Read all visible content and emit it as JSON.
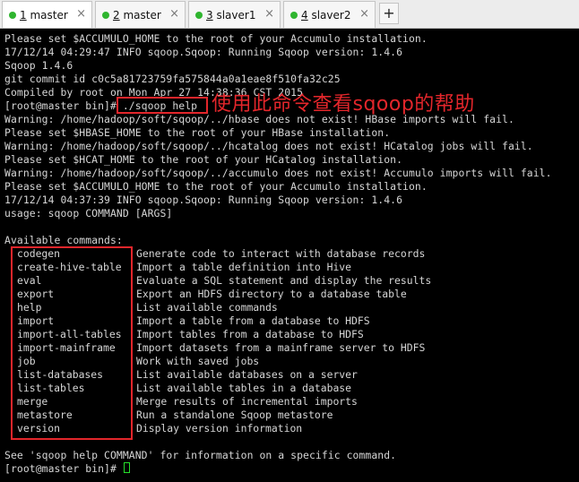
{
  "tabs": [
    {
      "number": "1",
      "label": "master",
      "dot_color": "#2fb52f",
      "active": true
    },
    {
      "number": "2",
      "label": "master",
      "dot_color": "#2fb52f",
      "active": false
    },
    {
      "number": "3",
      "label": "slaver1",
      "dot_color": "#2fb52f",
      "active": false
    },
    {
      "number": "4",
      "label": "slaver2",
      "dot_color": "#2fb52f",
      "active": false
    }
  ],
  "tab_close_glyph": "×",
  "add_tab_glyph": "+",
  "terminal": {
    "lines": [
      "Please set $ACCUMULO_HOME to the root of your Accumulo installation.",
      "17/12/14 04:29:47 INFO sqoop.Sqoop: Running Sqoop version: 1.4.6",
      "Sqoop 1.4.6",
      "git commit id c0c5a81723759fa575844a0a1eae8f510fa32c25",
      "Compiled by root on Mon Apr 27 14:38:36 CST 2015",
      "[root@master bin]# ./sqoop help",
      "Warning: /home/hadoop/soft/sqoop/../hbase does not exist! HBase imports will fail.",
      "Please set $HBASE_HOME to the root of your HBase installation.",
      "Warning: /home/hadoop/soft/sqoop/../hcatalog does not exist! HCatalog jobs will fail.",
      "Please set $HCAT_HOME to the root of your HCatalog installation.",
      "Warning: /home/hadoop/soft/sqoop/../accumulo does not exist! Accumulo imports will fail.",
      "Please set $ACCUMULO_HOME to the root of your Accumulo installation.",
      "17/12/14 04:37:39 INFO sqoop.Sqoop: Running Sqoop version: 1.4.6",
      "usage: sqoop COMMAND [ARGS]",
      "",
      "Available commands:"
    ],
    "commands": [
      {
        "name": "codegen",
        "desc": "Generate code to interact with database records"
      },
      {
        "name": "create-hive-table",
        "desc": "Import a table definition into Hive"
      },
      {
        "name": "eval",
        "desc": "Evaluate a SQL statement and display the results"
      },
      {
        "name": "export",
        "desc": "Export an HDFS directory to a database table"
      },
      {
        "name": "help",
        "desc": "List available commands"
      },
      {
        "name": "import",
        "desc": "Import a table from a database to HDFS"
      },
      {
        "name": "import-all-tables",
        "desc": "Import tables from a database to HDFS"
      },
      {
        "name": "import-mainframe",
        "desc": "Import datasets from a mainframe server to HDFS"
      },
      {
        "name": "job",
        "desc": "Work with saved jobs"
      },
      {
        "name": "list-databases",
        "desc": "List available databases on a server"
      },
      {
        "name": "list-tables",
        "desc": "List available tables in a database"
      },
      {
        "name": "merge",
        "desc": "Merge results of incremental imports"
      },
      {
        "name": "metastore",
        "desc": "Run a standalone Sqoop metastore"
      },
      {
        "name": "version",
        "desc": "Display version information"
      }
    ],
    "footer_lines": [
      "",
      "See 'sqoop help COMMAND' for information on a specific command.",
      "[root@master bin]# "
    ]
  },
  "annotation": "使用此命令查看sqoop的帮助",
  "colors": {
    "terminal_bg": "#000000",
    "terminal_fg": "#d6d6d6",
    "highlight_red": "#e3262b",
    "cursor_green": "#26e02b",
    "tab_dot_green": "#2fb52f"
  }
}
